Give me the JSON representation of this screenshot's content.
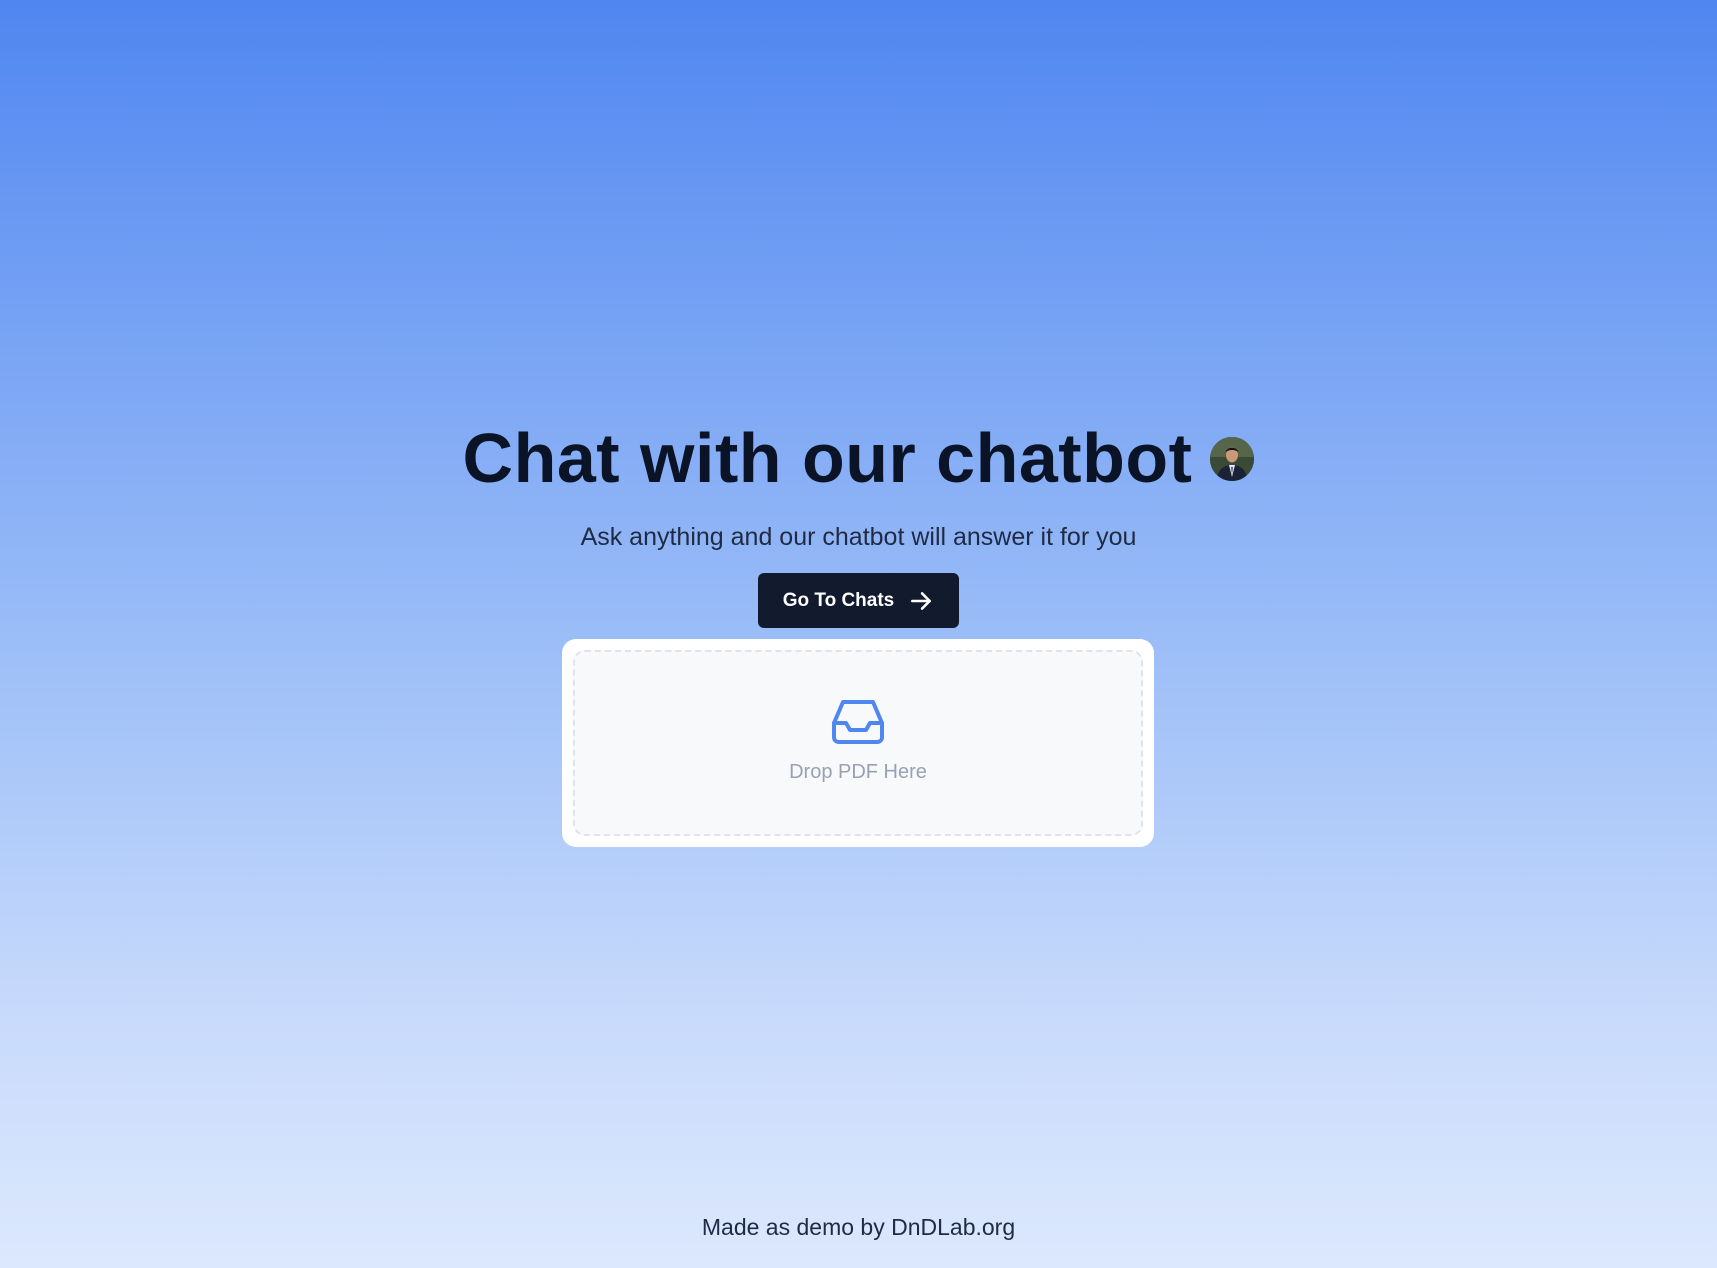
{
  "hero": {
    "title": "Chat with our chatbot",
    "subtitle": "Ask anything and our chatbot will answer it for you"
  },
  "cta": {
    "label": "Go To Chats",
    "icon": "arrow-right-icon"
  },
  "dropzone": {
    "label": "Drop PDF Here",
    "icon": "inbox-icon"
  },
  "footer": {
    "prefix": "Made as demo by ",
    "brand": "DnDLab.org"
  },
  "colors": {
    "gradient_top": "#4f86f0",
    "gradient_bottom": "#dce8fd",
    "button_bg": "#121a2e",
    "icon_accent": "#4f86f0",
    "title_text": "#0b1326"
  }
}
